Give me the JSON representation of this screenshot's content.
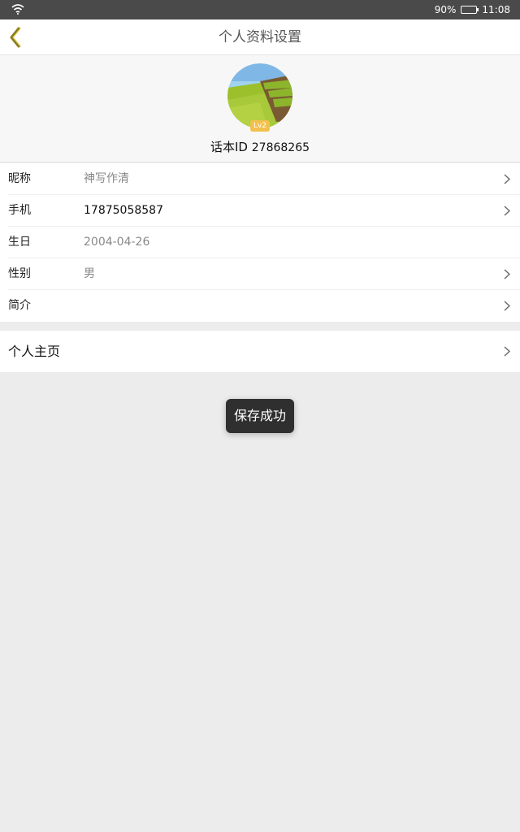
{
  "status_bar": {
    "battery_percent_text": "90%",
    "battery_level": 0.9,
    "time": "11:08",
    "icons": [
      "wifi-icon",
      "battery-icon"
    ]
  },
  "navbar": {
    "title": "个人资料设置",
    "back_icon": "chevron-left-icon",
    "accent_color": "#8a7a1c"
  },
  "profile": {
    "level_badge": "Lv2",
    "id_label": "话本ID",
    "id_value": "27868265",
    "badge_color": "#f2c14e"
  },
  "info_rows": [
    {
      "label": "昵称",
      "value": "神写作清",
      "has_chevron": true
    },
    {
      "label": "手机",
      "value": "17875058587",
      "has_chevron": true
    },
    {
      "label": "生日",
      "value": "2004-04-26",
      "has_chevron": false
    },
    {
      "label": "性别",
      "value": "男",
      "has_chevron": true
    },
    {
      "label": "简介",
      "value": "",
      "has_chevron": true
    }
  ],
  "homepage": {
    "label": "个人主页"
  },
  "toast": {
    "text": "保存成功"
  }
}
